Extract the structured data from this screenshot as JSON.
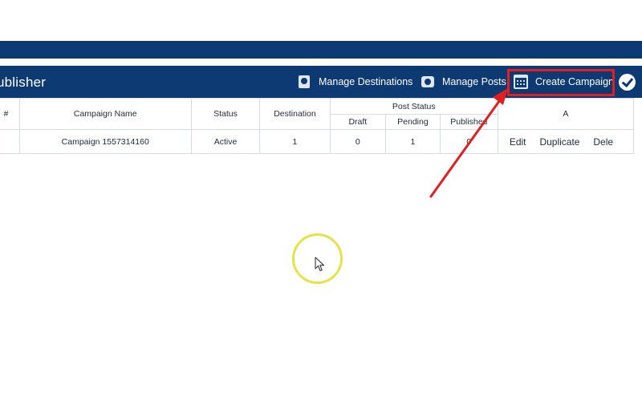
{
  "app": {
    "title": "ublisher"
  },
  "nav": {
    "manage_destinations": "Manage Destinations",
    "manage_posts": "Manage Posts",
    "create_campaign": "Create Campaign"
  },
  "table": {
    "headers": {
      "num": "#",
      "campaign_name": "Campaign Name",
      "status": "Status",
      "destination": "Destination",
      "post_status": "Post Status",
      "draft": "Draft",
      "pending": "Pending",
      "published": "Published",
      "actions": "A"
    },
    "rows": [
      {
        "campaign_name": "Campaign 1557314160",
        "status": "Active",
        "destination": "1",
        "draft": "0",
        "pending": "1",
        "published": "0",
        "actions": {
          "edit": "Edit",
          "duplicate": "Duplicate",
          "delete": "Dele"
        }
      }
    ]
  },
  "icons": {
    "manage_destinations": "destinations-icon",
    "manage_posts": "posts-icon",
    "create_campaign": "calendar-icon",
    "header_check": "check-circle-icon",
    "mouse": "mouse-pointer-icon"
  },
  "colors": {
    "header_bg": "#0e3a74",
    "highlight": "#e02020",
    "cursor_ring": "#e6e24a"
  }
}
